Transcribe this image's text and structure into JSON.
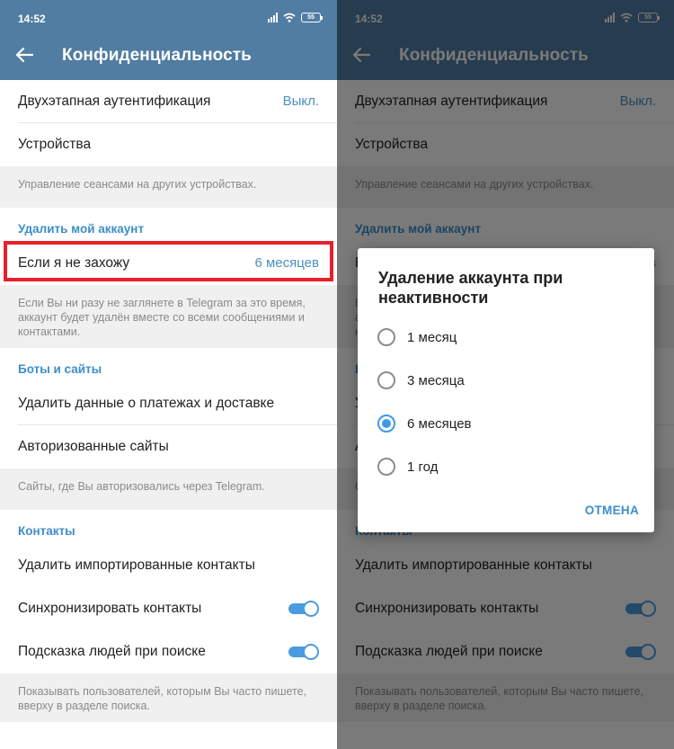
{
  "status": {
    "time": "14:52",
    "battery": "55"
  },
  "header": {
    "title": "Конфиденциальность"
  },
  "security": {
    "two_step_label": "Двухэтапная аутентификация",
    "two_step_value": "Выкл.",
    "devices_label": "Устройства",
    "sessions_info": "Управление сеансами на других устройствах."
  },
  "delete_account": {
    "section_title": "Удалить мой аккаунт",
    "if_away_label": "Если я не захожу",
    "if_away_value": "6 месяцев",
    "info": "Если Вы ни разу не заглянете в Telegram за это время, аккаунт будет удалён вместе со всеми сообщениями и контактами."
  },
  "bots": {
    "section_title": "Боты и сайты",
    "payments_label": "Удалить данные о платежах и доставке",
    "sites_label": "Авторизованные сайты",
    "info": "Сайты, где Вы авторизовались через Telegram."
  },
  "contacts": {
    "section_title": "Контакты",
    "delete_imported_label": "Удалить импортированные контакты",
    "sync_label": "Синхронизировать контакты",
    "sync_on": true,
    "suggest_label": "Подсказка людей при поиске",
    "suggest_on": true,
    "info": "Показывать пользователей, которым Вы часто пишете, вверху в разделе поиска."
  },
  "dialog": {
    "title": "Удаление аккаунта при неактивности",
    "options": [
      "1 месяц",
      "3 месяца",
      "6 месяцев",
      "1 год"
    ],
    "selected": "6 месяцев",
    "cancel_label": "ОТМЕНА"
  },
  "colors": {
    "appbar": "#527da3",
    "accent": "#3d8ec9",
    "highlight": "#e8202a"
  },
  "icons": [
    "back-arrow-icon",
    "signal-icon",
    "wifi-icon",
    "battery-icon",
    "radio-icon",
    "toggle-icon"
  ]
}
